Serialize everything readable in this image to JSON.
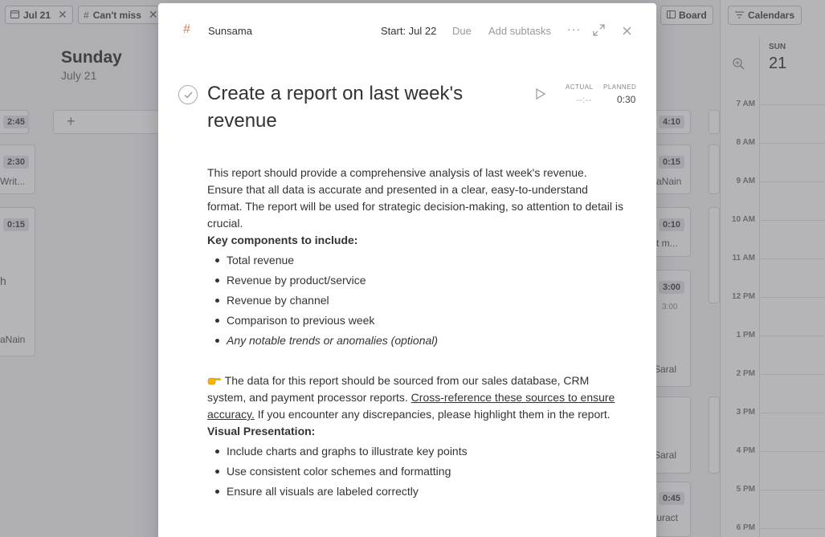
{
  "background": {
    "chips": [
      {
        "label": "Jul 21"
      },
      {
        "label": "Can't miss"
      }
    ],
    "column": {
      "title": "Sunday",
      "subtitle": "July 21"
    },
    "left_pills": [
      "2:45",
      "2:30",
      "0:15"
    ],
    "left_texts": [
      "Writ...",
      "h",
      "aNain"
    ],
    "right_pills": [
      "4:10",
      "0:15",
      "0:10",
      "3:00",
      "0:45"
    ],
    "right_texts": [
      "aNain",
      "t m...",
      "3:00",
      "Saral",
      "Saral",
      "turact"
    ],
    "board_label": "Board",
    "calendar": {
      "button_label": "Calendars",
      "day": "SUN",
      "date": "21",
      "hours": [
        "7 AM",
        "8 AM",
        "9 AM",
        "10 AM",
        "11 AM",
        "12 PM",
        "1 PM",
        "2 PM",
        "3 PM",
        "4 PM",
        "5 PM",
        "6 PM"
      ]
    }
  },
  "modal": {
    "channel": "Sunsama",
    "start": "Start: Jul 22",
    "due": "Due",
    "add_subtasks": "Add subtasks",
    "more": "···",
    "title": "Create a report on last week's revenue",
    "actual_label": "ACTUAL",
    "actual_value": "--:--",
    "planned_label": "PLANNED",
    "planned_value": "0:30",
    "intro": "This report should provide a comprehensive analysis of last week's revenue. Ensure that all data is accurate and presented in a clear, easy-to-understand format. The report will be used for strategic decision-making, so attention to detail is crucial.",
    "key_components_heading": "Key components to include:",
    "key_components": [
      "Total revenue",
      "Revenue by product/service",
      "Revenue by channel",
      "Comparison to previous week"
    ],
    "key_components_optional": "Any notable trends or anomalies (optional)",
    "source_text_before": "The data for this report should be sourced from our sales database, CRM system, and payment processor reports. ",
    "source_link": "Cross-reference these sources to ensure accuracy.",
    "source_text_after": " If you encounter any discrepancies, please highlight them in the report.",
    "visual_heading": "Visual Presentation:",
    "visual_items": [
      "Include charts and graphs to illustrate key points",
      "Use consistent color schemes and formatting",
      "Ensure all visuals are labeled correctly"
    ]
  },
  "colors": {
    "accent": "#e8794a",
    "overlay": "rgba(60,60,70,0.38)"
  }
}
